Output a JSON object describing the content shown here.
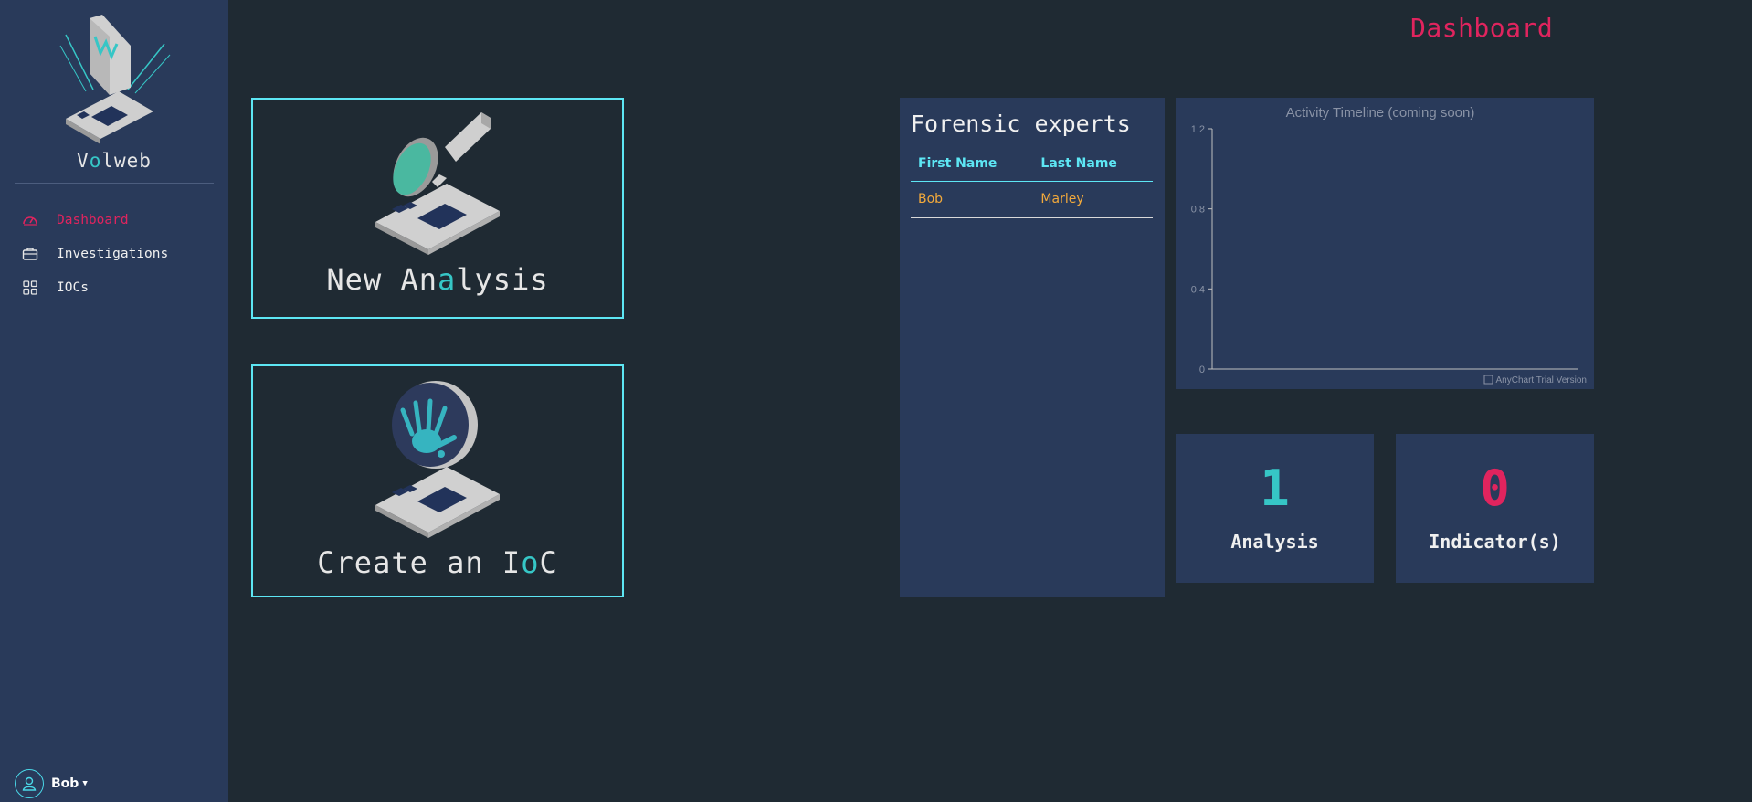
{
  "colors": {
    "accent": "#36c6c6",
    "danger": "#e0245e",
    "cyan": "#5de6f4",
    "orange": "#f2a93b",
    "panel": "#293a5a",
    "background": "#1f2a33"
  },
  "sidebar": {
    "brand": {
      "prefix": "V",
      "accent": "o",
      "suffix": "lweb"
    },
    "items": [
      {
        "label": "Dashboard",
        "icon": "speedometer-icon",
        "active": true
      },
      {
        "label": "Investigations",
        "icon": "briefcase-icon",
        "active": false
      },
      {
        "label": "IOCs",
        "icon": "grid-icon",
        "active": false
      }
    ],
    "user": {
      "name": "Bob",
      "icon": "person-icon"
    }
  },
  "header": {
    "title": "Dashboard"
  },
  "actions": {
    "new_analysis": {
      "prefix": "New An",
      "accent": "a",
      "suffix": "lysis",
      "icon": "magnifier-circuit-icon"
    },
    "create_ioc": {
      "prefix": "Create an I",
      "accent": "o",
      "suffix": "C",
      "icon": "handprint-circuit-icon"
    }
  },
  "experts": {
    "title": "Forensic experts",
    "columns": [
      "First Name",
      "Last Name"
    ],
    "rows": [
      [
        "Bob",
        "Marley"
      ]
    ]
  },
  "chart_data": {
    "type": "line",
    "title": "Activity Timeline (coming soon)",
    "xlabel": "",
    "ylabel": "",
    "y_ticks": [
      "0",
      "0.4",
      "0.8",
      "1.2"
    ],
    "ylim": [
      0,
      1.2
    ],
    "series": [],
    "grid": false,
    "watermark": "AnyChart Trial Version"
  },
  "stats": {
    "analysis": {
      "value": "1",
      "label": "Analysis"
    },
    "indicators": {
      "value": "0",
      "label": "Indicator(s)"
    }
  }
}
